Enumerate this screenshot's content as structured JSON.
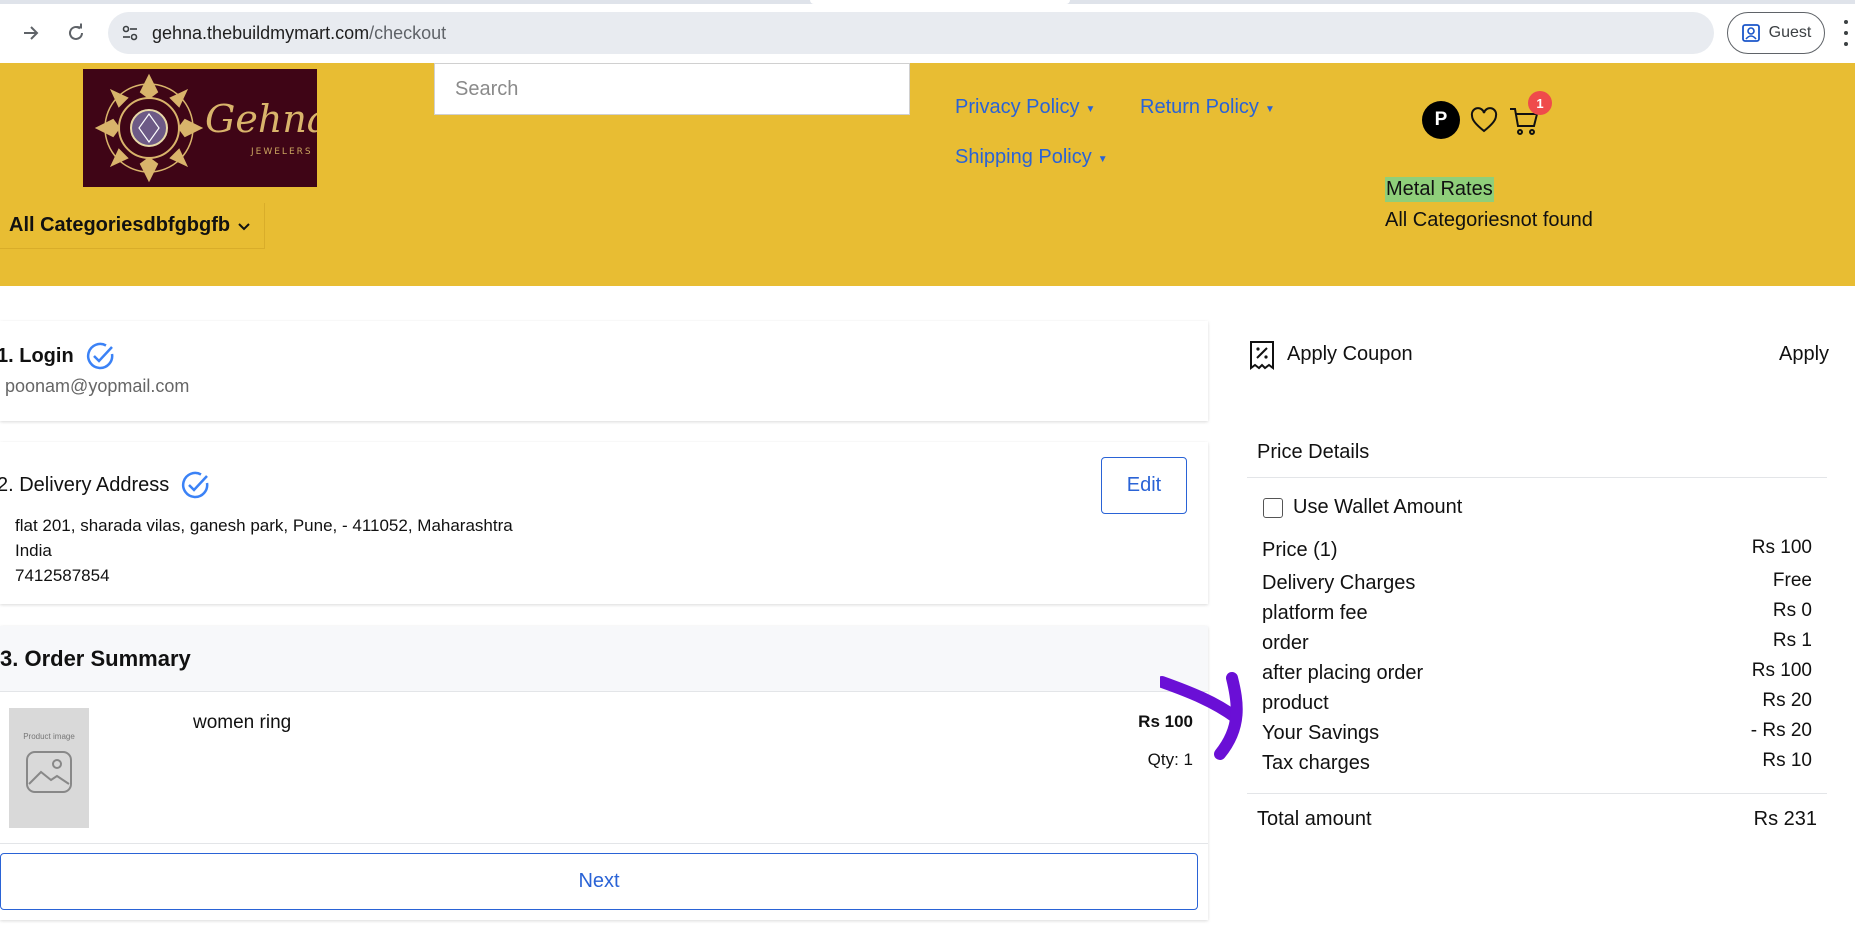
{
  "browser": {
    "url_host": "gehna.thebuildmymart.com",
    "url_path": "/checkout",
    "profile_label": "Guest",
    "icons": [
      "forward-icon",
      "reload-icon",
      "site-settings-icon",
      "profile-icon",
      "menu-icon"
    ]
  },
  "header": {
    "logo_text": "Gehna",
    "logo_sub": "JEWELERS",
    "search_placeholder": "Search",
    "policies": [
      "Privacy Policy",
      "Return Policy",
      "Shipping Policy"
    ],
    "avatar_initial": "P",
    "cart_count": "1",
    "metal_rates": "Metal Rates",
    "categories_status": "All Categoriesnot found",
    "category_menu": "All Categoriesdbfgbgfb"
  },
  "checkout": {
    "login": {
      "title": "1. Login",
      "email": "poonam@yopmail.com"
    },
    "delivery": {
      "title": "2. Delivery Address",
      "edit_label": "Edit",
      "address_line": "flat 201, sharada vilas, ganesh park, Pune, - 411052, Maharashtra",
      "country": "India",
      "phone": "7412587854"
    },
    "summary": {
      "title": "3. Order Summary",
      "product_image_caption": "Product image",
      "product_name": "women ring",
      "product_price": "Rs 100",
      "product_qty": "Qty: 1",
      "next_label": "Next"
    }
  },
  "coupon": {
    "label": "Apply Coupon",
    "apply": "Apply"
  },
  "price_details": {
    "title": "Price Details",
    "wallet_label": "Use Wallet Amount",
    "rows": [
      {
        "label": "Price (1)",
        "value": "Rs 100"
      },
      {
        "label": "Delivery Charges",
        "value": "Free"
      },
      {
        "label": "platform fee",
        "value": "Rs 0"
      },
      {
        "label": "order",
        "value": "Rs 1"
      },
      {
        "label": "after placing order",
        "value": "Rs 100"
      },
      {
        "label": "product",
        "value": "Rs 20"
      },
      {
        "label": "Your Savings",
        "value": "- Rs 20"
      },
      {
        "label": "Tax charges",
        "value": "Rs 10"
      }
    ],
    "total_label": "Total amount",
    "total_value": "Rs 231"
  },
  "colors": {
    "header_bg": "#e8bd33",
    "link_blue": "#2a63d6",
    "logo_bg": "#3f0516",
    "metal_rates_bg": "#8fcf7a",
    "annotation": "#6a0fd6",
    "badge": "#ef4b4b"
  }
}
